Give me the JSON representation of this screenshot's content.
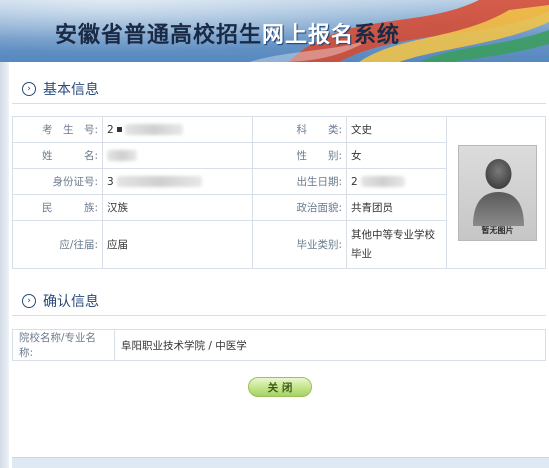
{
  "header": {
    "title_prefix": "安徽省普通高校招生",
    "title_highlight": "网上报名",
    "title_suffix": "系统"
  },
  "basic_info": {
    "section_title": "基本信息",
    "rows": [
      {
        "label_left": "考　生　号:",
        "value_left": "2",
        "label_right": "科　　类:",
        "value_right": "文史"
      },
      {
        "label_left": "姓　　　名:",
        "value_left": "",
        "label_right": "性　　别:",
        "value_right": "女"
      },
      {
        "label_left": "身份证号:",
        "value_left": "3",
        "label_right": "出生日期:",
        "value_right": "2"
      },
      {
        "label_left": "民　　　族:",
        "value_left": "汉族",
        "label_right": "政治面貌:",
        "value_right": "共青团员"
      },
      {
        "label_left": "应/往届:",
        "value_left": "应届",
        "label_right": "毕业类别:",
        "value_right": "其他中等专业学校毕业"
      }
    ],
    "photo_caption": "暂无图片"
  },
  "confirm_info": {
    "section_title": "确认信息",
    "label": "院校名称/专业名称:",
    "value": "阜阳职业技术学院 / 中医学"
  },
  "actions": {
    "close_label": "关 闭"
  },
  "colors": {
    "accent": "#2a4a7a",
    "label": "#6b7b8e",
    "border": "#d9dfe8",
    "button_green": "#c3e48a"
  },
  "icons": {
    "section_marker": "circle-chevron-icon",
    "photo_placeholder": "person-silhouette-icon"
  }
}
